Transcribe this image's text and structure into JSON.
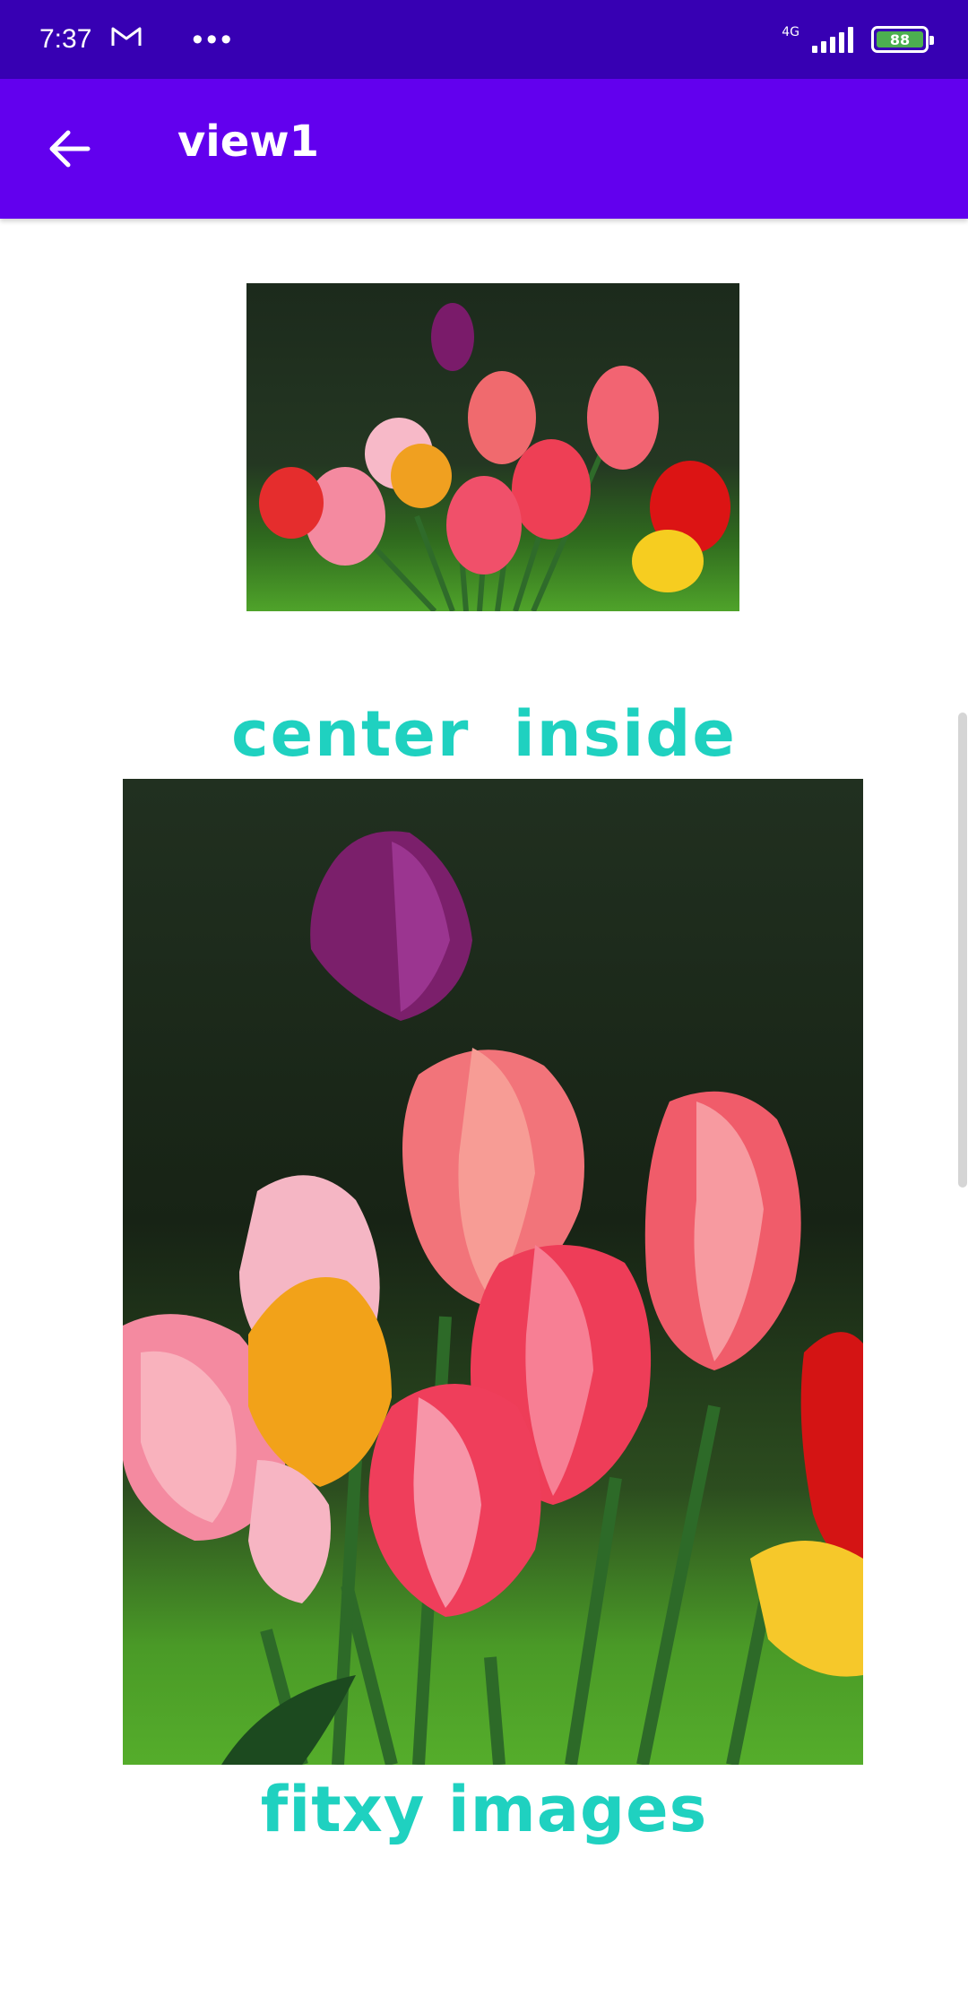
{
  "status_bar": {
    "time": "7:37",
    "network": "4G",
    "battery": "88",
    "notification_icons": [
      "gmail-icon",
      "more-dots-icon"
    ]
  },
  "app_bar": {
    "title": "view1",
    "back_icon": "arrow-back-icon"
  },
  "content": {
    "image1_caption": "center  inside",
    "image2_caption": "fitxy images"
  },
  "colors": {
    "status_bar": "#3700b3",
    "app_bar": "#6200ee",
    "caption": "#1fd1c0"
  }
}
